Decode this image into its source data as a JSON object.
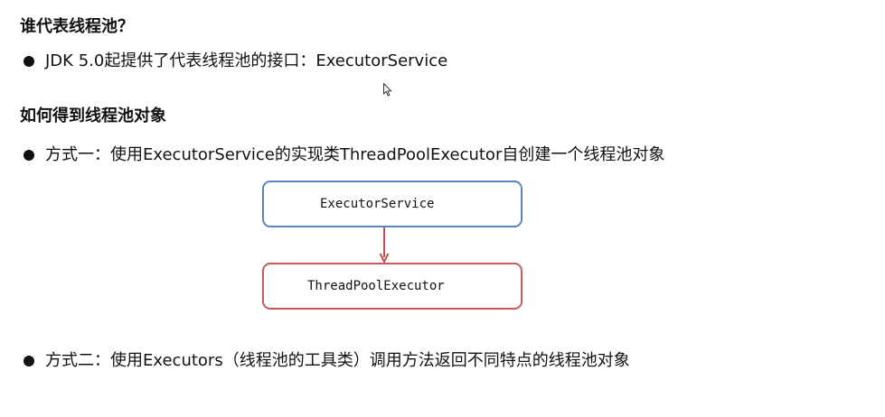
{
  "section1": {
    "title": "谁代表线程池？",
    "bullet": "JDK 5.0起提供了代表线程池的接口：ExecutorService"
  },
  "section2": {
    "title": "如何得到线程池对象",
    "method1": "方式一：使用ExecutorService的实现类ThreadPoolExecutor自创建一个线程池对象",
    "method2": "方式二：使用Executors（线程池的工具类）调用方法返回不同特点的线程池对象"
  },
  "diagram": {
    "interface_label": "ExecutorService",
    "impl_label": "ThreadPoolExecutor",
    "interface_border_color": "#5a84c2",
    "impl_border_color": "#c95a5a",
    "arrow_color": "#c0504d"
  },
  "icons": {
    "cursor": "mouse-pointer-icon",
    "bullet": "bullet-dot-icon"
  }
}
